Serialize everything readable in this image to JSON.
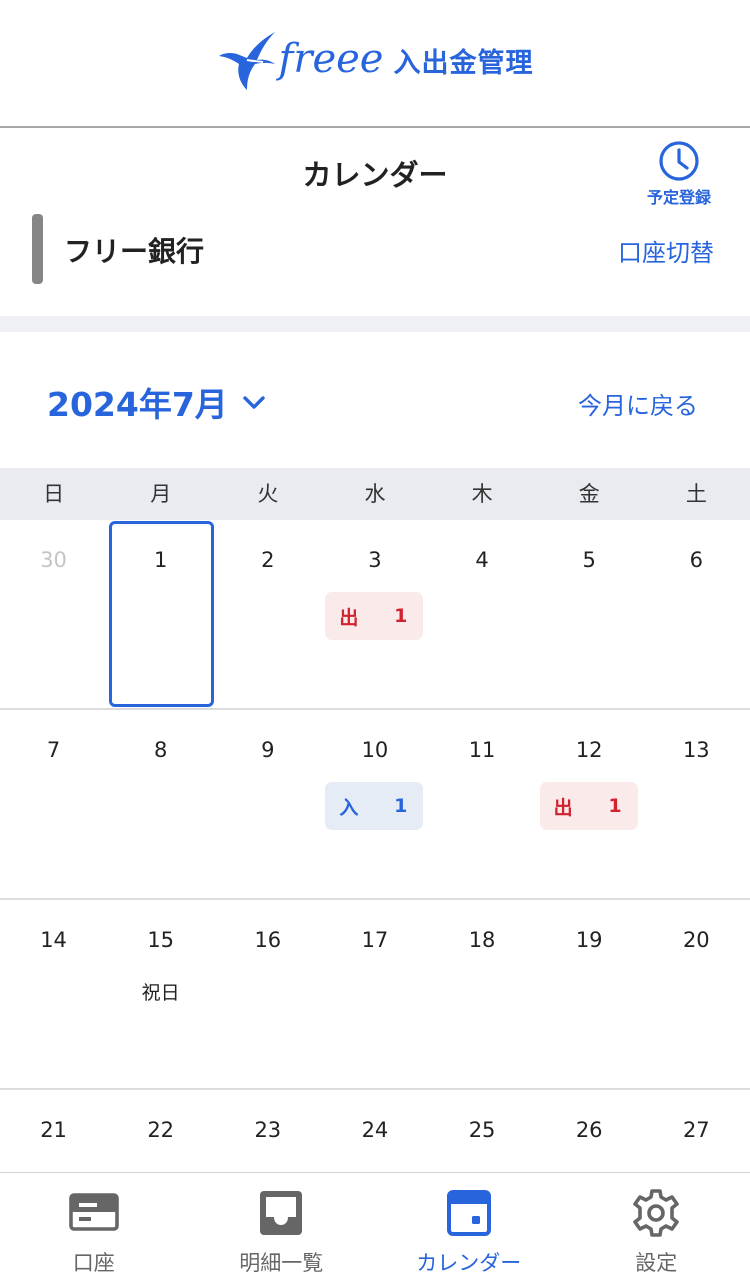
{
  "brand": {
    "wordmark": "freee",
    "product": "入出金管理",
    "color": "#2864dc"
  },
  "header": {
    "title": "カレンダー",
    "schedule_button": {
      "label": "予定登録",
      "icon": "clock-icon"
    },
    "account_name": "フリー銀行",
    "account_switch": "口座切替"
  },
  "calendar": {
    "month_label": "2024年7月",
    "back_to_current": "今月に戻る",
    "weekdays": [
      "日",
      "月",
      "火",
      "水",
      "木",
      "金",
      "土"
    ],
    "weeks": [
      [
        {
          "day": "30",
          "outside": true
        },
        {
          "day": "1",
          "today": true
        },
        {
          "day": "2"
        },
        {
          "day": "3",
          "badge": {
            "type": "out",
            "label": "出",
            "count": "1"
          }
        },
        {
          "day": "4"
        },
        {
          "day": "5"
        },
        {
          "day": "6"
        }
      ],
      [
        {
          "day": "7"
        },
        {
          "day": "8"
        },
        {
          "day": "9"
        },
        {
          "day": "10",
          "badge": {
            "type": "in",
            "label": "入",
            "count": "1"
          }
        },
        {
          "day": "11"
        },
        {
          "day": "12",
          "badge": {
            "type": "out",
            "label": "出",
            "count": "1"
          }
        },
        {
          "day": "13"
        }
      ],
      [
        {
          "day": "14"
        },
        {
          "day": "15",
          "note": "祝日"
        },
        {
          "day": "16"
        },
        {
          "day": "17"
        },
        {
          "day": "18"
        },
        {
          "day": "19"
        },
        {
          "day": "20"
        }
      ],
      [
        {
          "day": "21"
        },
        {
          "day": "22"
        },
        {
          "day": "23"
        },
        {
          "day": "24"
        },
        {
          "day": "25"
        },
        {
          "day": "26"
        },
        {
          "day": "27"
        }
      ]
    ],
    "colors": {
      "out_bg": "#fbeaea",
      "out_text": "#d0222f",
      "in_bg": "#e6ecf6",
      "in_text": "#2864dc"
    }
  },
  "bottom_nav": {
    "items": [
      {
        "label": "口座",
        "icon": "bank-card-icon",
        "active": false
      },
      {
        "label": "明細一覧",
        "icon": "inbox-tray-icon",
        "active": false
      },
      {
        "label": "カレンダー",
        "icon": "calendar-icon",
        "active": true
      },
      {
        "label": "設定",
        "icon": "gear-icon",
        "active": false
      }
    ]
  }
}
